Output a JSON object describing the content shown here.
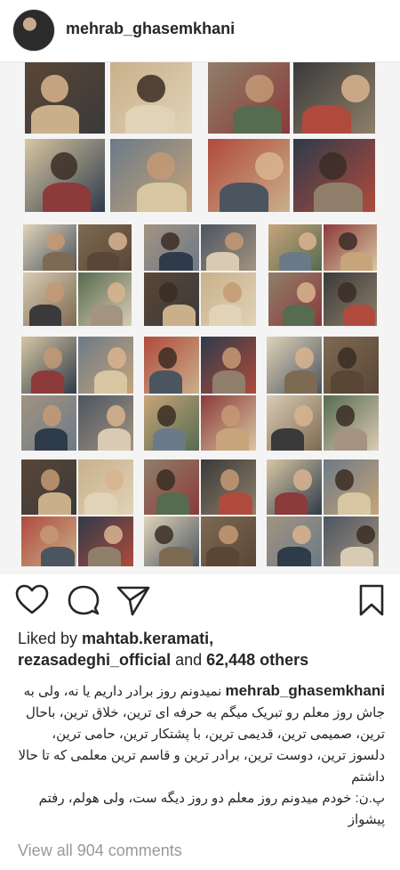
{
  "post": {
    "username": "mehrab_ghasemkhani",
    "likes_prefix": "Liked by ",
    "liker_1": "mahtab.keramati,",
    "liker_2": "rezasadeghi_official",
    "likes_mid": " and ",
    "likes_count": "62,448 others",
    "caption_user": "mehrab_ghasemkhani",
    "caption_text": "نمیدونم روز برادر داریم یا نه، ولی به جاش روز معلم رو تبریک میگم به حرفه ای ترین، خلاق ترین، باحال ترین، صمیمی ترین، قدیمی ترین، با پشتکار ترین، حامی ترین، دلسوز ترین، دوست ترین، برادر ترین و قاسم ترین معلمی که تا حالا داشتم",
    "caption_ps": "پ.ن: خودم میدونم روز معلم دو روز دیگه ست، ولی هولم، رفتم پیشواز",
    "view_all": "View all 904 comments"
  },
  "icons": {
    "like": "heart-icon",
    "comment": "comment-bubble-icon",
    "share": "paper-plane-icon",
    "save": "bookmark-icon"
  },
  "collage": {
    "description_tiles": 64,
    "palette": [
      "#5a4636",
      "#c9b08a",
      "#8f7f6a",
      "#3a3a3a",
      "#d8c6a3",
      "#6b7a88",
      "#b04a3c",
      "#2e3b4a",
      "#e0d3b8",
      "#7d6a52",
      "#a39380",
      "#4b5560",
      "#c7a47a",
      "#8c3a3a",
      "#d9cbb3",
      "#566b4f"
    ]
  }
}
